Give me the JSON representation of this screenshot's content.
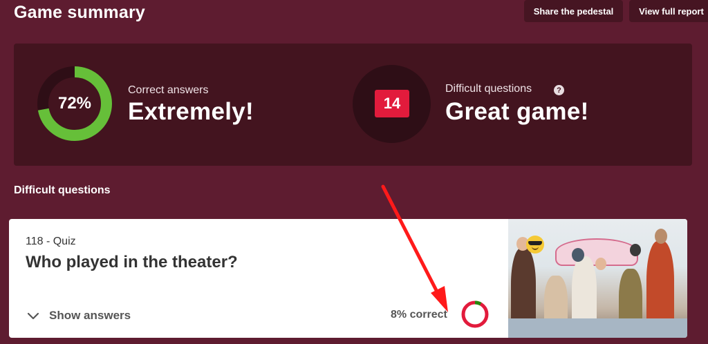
{
  "header": {
    "title": "Game summary",
    "share_label": "Share the pedestal",
    "report_label": "View full report"
  },
  "summary": {
    "correct": {
      "percent_label": "72%",
      "percent_value": 72,
      "label": "Correct answers",
      "value": "Extremely!"
    },
    "difficult": {
      "count": "14",
      "label": "Difficult questions",
      "help_glyph": "?",
      "value": "Great game!"
    }
  },
  "difficult_section": {
    "title": "Difficult questions",
    "questions": [
      {
        "number_label": "118 -",
        "type": "Quiz",
        "title": "Who played in the theater?",
        "show_answers_label": "Show answers",
        "correct_label": "8% correct",
        "correct_percent": 8,
        "image_icon": "theater-photo",
        "emoji_icon": "sunglasses-emoji-icon"
      }
    ]
  },
  "colors": {
    "background": "#5e1c30",
    "card": "#43141f",
    "ring_green": "#66bf39",
    "ring_track": "#2e0e16",
    "badge_red": "#e21b3c",
    "mini_ring_red": "#e21b3c",
    "mini_ring_green": "#26890c",
    "annotation_red": "#ff1a1a"
  }
}
